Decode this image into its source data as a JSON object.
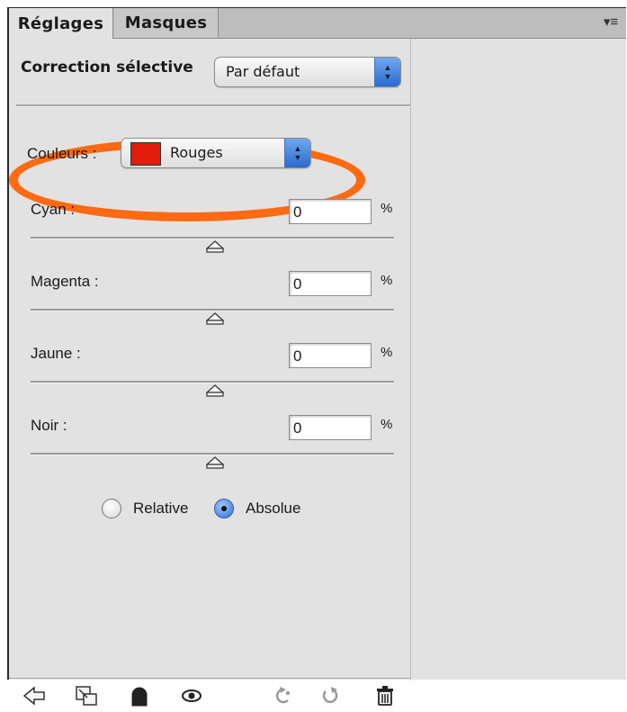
{
  "tabs": [
    {
      "label": "Réglages",
      "active": true
    },
    {
      "label": "Masques",
      "active": false
    }
  ],
  "panel_menu_icon": "panel-menu-icon",
  "adjustment": {
    "title": "Correction sélective",
    "preset_value": "Par défaut"
  },
  "colors": {
    "label": "Couleurs :",
    "value": "Rouges",
    "swatch_color": "#e01c0b",
    "highlight_color": "#ff6a13"
  },
  "sliders": [
    {
      "label": "Cyan :",
      "value": "0",
      "unit": "%"
    },
    {
      "label": "Magenta :",
      "value": "0",
      "unit": "%"
    },
    {
      "label": "Jaune :",
      "value": "0",
      "unit": "%"
    },
    {
      "label": "Noir :",
      "value": "0",
      "unit": "%"
    }
  ],
  "method": {
    "options": [
      "Relative",
      "Absolue"
    ],
    "selected": "Absolue"
  },
  "footer_icons": [
    "back-arrow-icon",
    "clip-to-layer-icon",
    "layer-visibility-mask-icon",
    "eye-icon",
    "previous-state-icon",
    "reset-icon",
    "trash-icon"
  ]
}
